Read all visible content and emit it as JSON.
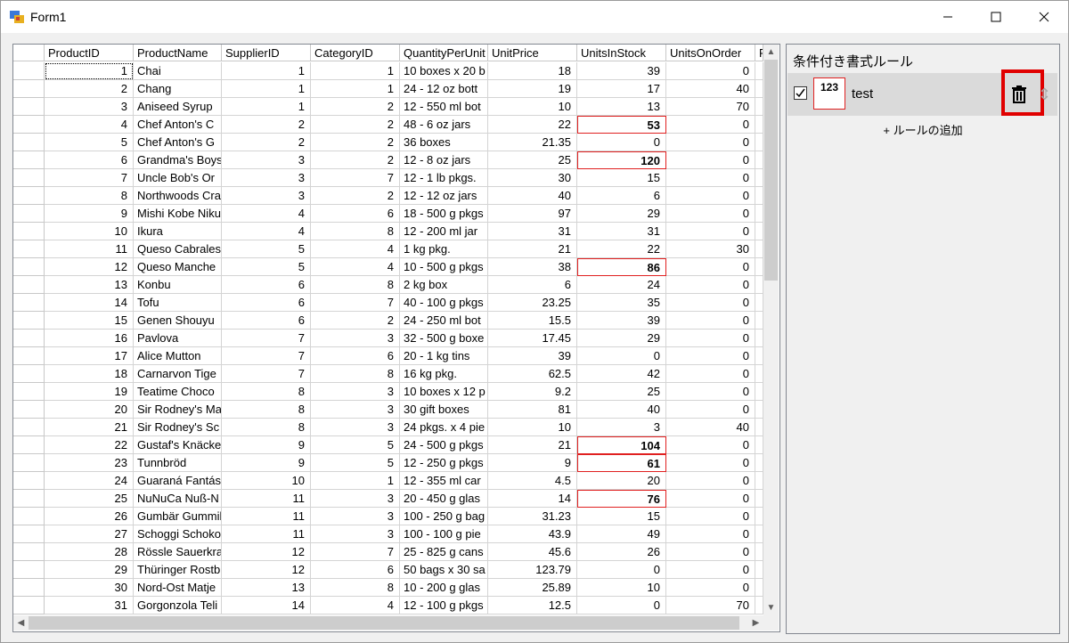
{
  "window": {
    "title": "Form1"
  },
  "grid": {
    "columns": [
      "ProductID",
      "ProductName",
      "SupplierID",
      "CategoryID",
      "QuantityPerUnit",
      "UnitPrice",
      "UnitsInStock",
      "UnitsOnOrder",
      "R"
    ],
    "rows": [
      {
        "id": "1",
        "name": "Chai",
        "sup": "1",
        "cat": "1",
        "qty": "10 boxes x 20 b",
        "price": "18",
        "stock": "39",
        "order": "0"
      },
      {
        "id": "2",
        "name": "Chang",
        "sup": "1",
        "cat": "1",
        "qty": "24 - 12 oz bott",
        "price": "19",
        "stock": "17",
        "order": "40"
      },
      {
        "id": "3",
        "name": "Aniseed Syrup",
        "sup": "1",
        "cat": "2",
        "qty": "12 - 550 ml bot",
        "price": "10",
        "stock": "13",
        "order": "70"
      },
      {
        "id": "4",
        "name": "Chef Anton's C",
        "sup": "2",
        "cat": "2",
        "qty": "48 - 6 oz jars",
        "price": "22",
        "stock": "53",
        "order": "0",
        "hl": true
      },
      {
        "id": "5",
        "name": "Chef Anton's G",
        "sup": "2",
        "cat": "2",
        "qty": "36 boxes",
        "price": "21.35",
        "stock": "0",
        "order": "0"
      },
      {
        "id": "6",
        "name": "Grandma's Boys",
        "sup": "3",
        "cat": "2",
        "qty": "12 - 8 oz jars",
        "price": "25",
        "stock": "120",
        "order": "0",
        "hl": true
      },
      {
        "id": "7",
        "name": "Uncle Bob's Or",
        "sup": "3",
        "cat": "7",
        "qty": "12 - 1 lb pkgs.",
        "price": "30",
        "stock": "15",
        "order": "0"
      },
      {
        "id": "8",
        "name": "Northwoods Cra",
        "sup": "3",
        "cat": "2",
        "qty": "12 - 12 oz jars",
        "price": "40",
        "stock": "6",
        "order": "0"
      },
      {
        "id": "9",
        "name": "Mishi Kobe Niku",
        "sup": "4",
        "cat": "6",
        "qty": "18 - 500 g pkgs",
        "price": "97",
        "stock": "29",
        "order": "0"
      },
      {
        "id": "10",
        "name": "Ikura",
        "sup": "4",
        "cat": "8",
        "qty": "12 - 200 ml jar",
        "price": "31",
        "stock": "31",
        "order": "0"
      },
      {
        "id": "11",
        "name": "Queso Cabrales",
        "sup": "5",
        "cat": "4",
        "qty": "1 kg pkg.",
        "price": "21",
        "stock": "22",
        "order": "30"
      },
      {
        "id": "12",
        "name": "Queso Manche",
        "sup": "5",
        "cat": "4",
        "qty": "10 - 500 g pkgs",
        "price": "38",
        "stock": "86",
        "order": "0",
        "hl": true
      },
      {
        "id": "13",
        "name": "Konbu",
        "sup": "6",
        "cat": "8",
        "qty": "2 kg box",
        "price": "6",
        "stock": "24",
        "order": "0"
      },
      {
        "id": "14",
        "name": "Tofu",
        "sup": "6",
        "cat": "7",
        "qty": "40 - 100 g pkgs",
        "price": "23.25",
        "stock": "35",
        "order": "0"
      },
      {
        "id": "15",
        "name": "Genen Shouyu",
        "sup": "6",
        "cat": "2",
        "qty": "24 - 250 ml bot",
        "price": "15.5",
        "stock": "39",
        "order": "0"
      },
      {
        "id": "16",
        "name": "Pavlova",
        "sup": "7",
        "cat": "3",
        "qty": "32 - 500 g boxe",
        "price": "17.45",
        "stock": "29",
        "order": "0"
      },
      {
        "id": "17",
        "name": "Alice Mutton",
        "sup": "7",
        "cat": "6",
        "qty": "20 - 1 kg tins",
        "price": "39",
        "stock": "0",
        "order": "0"
      },
      {
        "id": "18",
        "name": "Carnarvon Tige",
        "sup": "7",
        "cat": "8",
        "qty": "16 kg pkg.",
        "price": "62.5",
        "stock": "42",
        "order": "0"
      },
      {
        "id": "19",
        "name": "Teatime Choco",
        "sup": "8",
        "cat": "3",
        "qty": "10 boxes x 12 p",
        "price": "9.2",
        "stock": "25",
        "order": "0"
      },
      {
        "id": "20",
        "name": "Sir Rodney's Ma",
        "sup": "8",
        "cat": "3",
        "qty": "30 gift boxes",
        "price": "81",
        "stock": "40",
        "order": "0"
      },
      {
        "id": "21",
        "name": "Sir Rodney's Sc",
        "sup": "8",
        "cat": "3",
        "qty": "24 pkgs. x 4 pie",
        "price": "10",
        "stock": "3",
        "order": "40"
      },
      {
        "id": "22",
        "name": "Gustaf's Knäcke",
        "sup": "9",
        "cat": "5",
        "qty": "24 - 500 g pkgs",
        "price": "21",
        "stock": "104",
        "order": "0",
        "hl": true
      },
      {
        "id": "23",
        "name": "Tunnbröd",
        "sup": "9",
        "cat": "5",
        "qty": "12 - 250 g pkgs",
        "price": "9",
        "stock": "61",
        "order": "0",
        "hl": true
      },
      {
        "id": "24",
        "name": "Guaraná Fantás",
        "sup": "10",
        "cat": "1",
        "qty": "12 - 355 ml car",
        "price": "4.5",
        "stock": "20",
        "order": "0"
      },
      {
        "id": "25",
        "name": "NuNuCa Nuß-N",
        "sup": "11",
        "cat": "3",
        "qty": "20 - 450 g glas",
        "price": "14",
        "stock": "76",
        "order": "0",
        "hl": true
      },
      {
        "id": "26",
        "name": "Gumbär Gummib",
        "sup": "11",
        "cat": "3",
        "qty": "100 - 250 g bag",
        "price": "31.23",
        "stock": "15",
        "order": "0"
      },
      {
        "id": "27",
        "name": "Schoggi Schoko",
        "sup": "11",
        "cat": "3",
        "qty": "100 - 100 g pie",
        "price": "43.9",
        "stock": "49",
        "order": "0"
      },
      {
        "id": "28",
        "name": "Rössle Sauerkra",
        "sup": "12",
        "cat": "7",
        "qty": "25 - 825 g cans",
        "price": "45.6",
        "stock": "26",
        "order": "0"
      },
      {
        "id": "29",
        "name": "Thüringer Rostb",
        "sup": "12",
        "cat": "6",
        "qty": "50 bags x 30 sa",
        "price": "123.79",
        "stock": "0",
        "order": "0"
      },
      {
        "id": "30",
        "name": "Nord-Ost Matje",
        "sup": "13",
        "cat": "8",
        "qty": "10 - 200 g glas",
        "price": "25.89",
        "stock": "10",
        "order": "0"
      },
      {
        "id": "31",
        "name": "Gorgonzola Teli",
        "sup": "14",
        "cat": "4",
        "qty": "12 - 100 g pkgs",
        "price": "12.5",
        "stock": "0",
        "order": "70"
      }
    ]
  },
  "panel": {
    "title": "条件付き書式ルール",
    "rule": {
      "preview": "123",
      "name": "test"
    },
    "add_rule": "+ ルールの追加"
  },
  "colors": {
    "highlight": "#e02020"
  }
}
